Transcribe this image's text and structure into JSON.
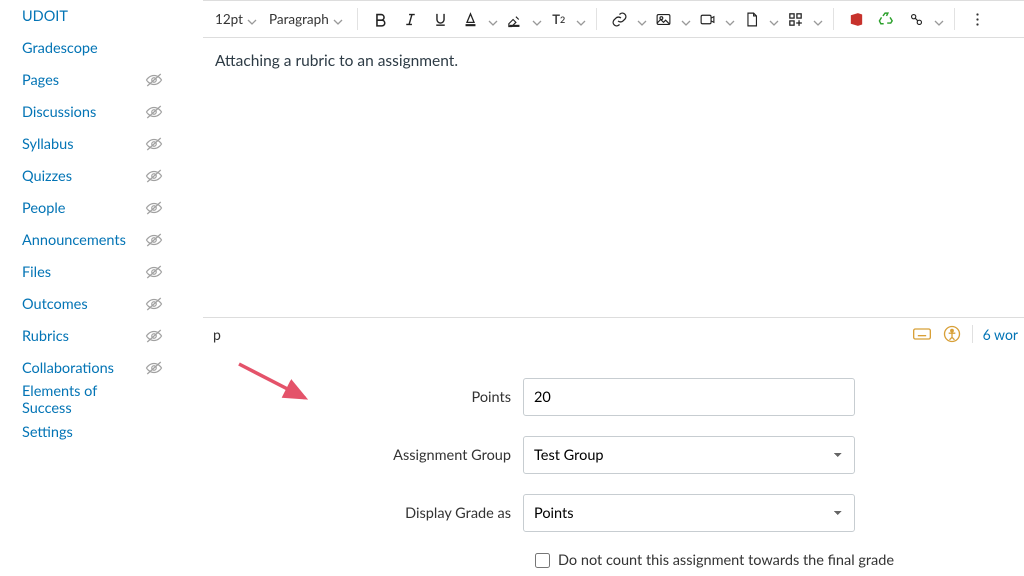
{
  "sidebar": {
    "items": [
      {
        "label": "UDOIT",
        "hidden": false
      },
      {
        "label": "Gradescope",
        "hidden": false
      },
      {
        "label": "Pages",
        "hidden": true
      },
      {
        "label": "Discussions",
        "hidden": true
      },
      {
        "label": "Syllabus",
        "hidden": true
      },
      {
        "label": "Quizzes",
        "hidden": true
      },
      {
        "label": "People",
        "hidden": true
      },
      {
        "label": "Announcements",
        "hidden": true
      },
      {
        "label": "Files",
        "hidden": true
      },
      {
        "label": "Outcomes",
        "hidden": true
      },
      {
        "label": "Rubrics",
        "hidden": true
      },
      {
        "label": "Collaborations",
        "hidden": true
      },
      {
        "label": "Elements of Success",
        "hidden": false
      },
      {
        "label": "Settings",
        "hidden": false
      }
    ]
  },
  "toolbar": {
    "font_size": "12pt",
    "block": "Paragraph"
  },
  "editor": {
    "content": "Attaching a rubric to an assignment.",
    "path": "p",
    "word_count_text": "6 wor"
  },
  "form": {
    "points_label": "Points",
    "points_value": "20",
    "group_label": "Assignment Group",
    "group_value": "Test Group",
    "display_label": "Display Grade as",
    "display_value": "Points",
    "final_grade_label": "Do not count this assignment towards the final grade"
  }
}
